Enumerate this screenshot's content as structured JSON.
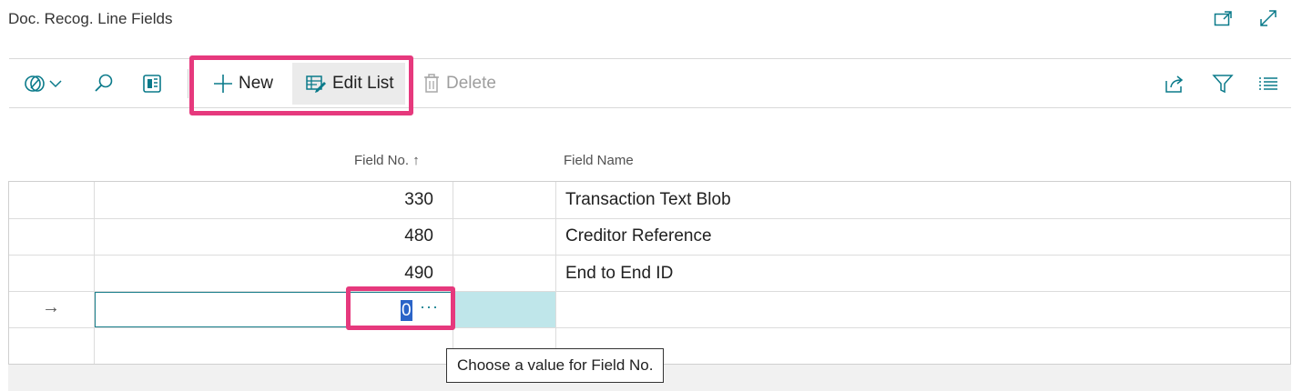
{
  "page": {
    "title": "Doc. Recog. Line Fields"
  },
  "window": {
    "open_new_icon": "open-new-window-icon",
    "expand_icon": "expand-icon"
  },
  "toolbar": {
    "new_label": "New",
    "edit_list_label": "Edit List",
    "delete_label": "Delete"
  },
  "columns": {
    "field_no": "Field No.",
    "sort_indicator": "↑",
    "field_name": "Field Name"
  },
  "rows": [
    {
      "field_no": "330",
      "field_name": "Transaction Text Blob"
    },
    {
      "field_no": "480",
      "field_name": "Creditor Reference"
    },
    {
      "field_no": "490",
      "field_name": "End to End ID"
    }
  ],
  "new_row": {
    "indicator": "→",
    "field_no_value": "0",
    "lookup": "···"
  },
  "tooltip": {
    "text": "Choose a value for Field No."
  },
  "colors": {
    "accent": "#0a7a8a",
    "highlight": "#e6397d",
    "selected_cell": "#bfe6ea"
  }
}
